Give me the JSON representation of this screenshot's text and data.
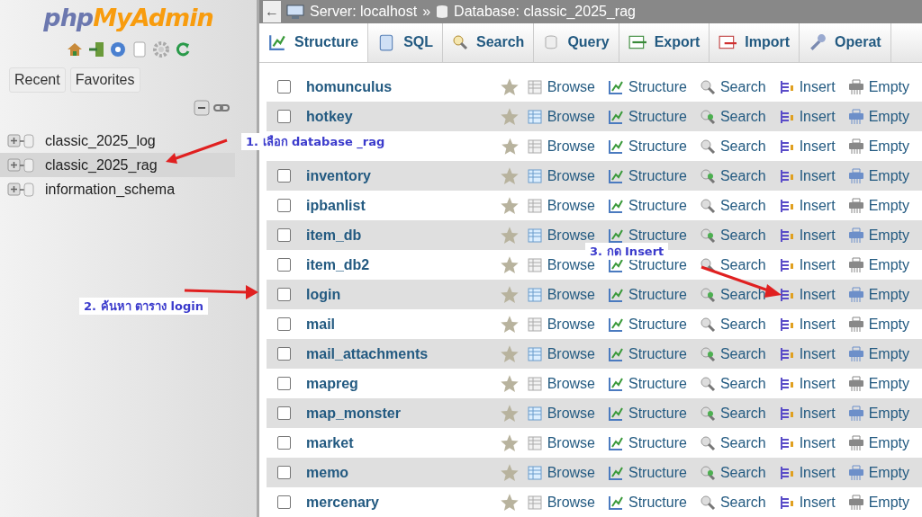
{
  "sidebar": {
    "logo": {
      "php": "php",
      "rest": "MyAdmin"
    },
    "buttons": [
      "Recent",
      "Favorites"
    ],
    "databases": [
      {
        "name": "classic_2025_log",
        "selected": false
      },
      {
        "name": "classic_2025_rag",
        "selected": true
      },
      {
        "name": "information_schema",
        "selected": false
      }
    ]
  },
  "breadcrumb": {
    "back": "←",
    "server": "Server: localhost",
    "separator": "»",
    "database": "Database: classic_2025_rag"
  },
  "tabs": [
    {
      "label": "Structure",
      "selected": true
    },
    {
      "label": "SQL",
      "selected": false
    },
    {
      "label": "Search",
      "selected": false
    },
    {
      "label": "Query",
      "selected": false
    },
    {
      "label": "Export",
      "selected": false
    },
    {
      "label": "Import",
      "selected": false
    },
    {
      "label": "Operat",
      "selected": false
    }
  ],
  "rows": [
    {
      "name": "homunculus",
      "checked": false,
      "actions": [
        "Browse",
        "Structure",
        "Search",
        "Insert",
        "Empty"
      ]
    },
    {
      "name": "hotkey",
      "checked": false,
      "actions": [
        "Browse",
        "Structure",
        "Search",
        "Insert",
        "Empty"
      ]
    },
    {
      "actions": [
        "Browse",
        "Structure",
        "Search",
        "Insert",
        "Empty"
      ]
    },
    {
      "name": "inventory",
      "checked": false,
      "actions": [
        "Browse",
        "Structure",
        "Search",
        "Insert",
        "Empty"
      ]
    },
    {
      "name": "ipbanlist",
      "checked": false,
      "actions": [
        "Browse",
        "Structure",
        "Search",
        "Insert",
        "Empty"
      ]
    },
    {
      "name": "item_db",
      "checked": false,
      "actions": [
        "Browse",
        "Structure",
        "Search",
        "Insert",
        "Empty"
      ]
    },
    {
      "name": "item_db2",
      "checked": false,
      "actions": [
        "Browse",
        "Structure",
        "Search",
        "Insert",
        "Empty"
      ]
    },
    {
      "name": "login",
      "checked": false,
      "actions": [
        "Browse",
        "Structure",
        "Search",
        "Insert",
        "Empty"
      ]
    },
    {
      "name": "mail",
      "checked": false,
      "actions": [
        "Browse",
        "Structure",
        "Search",
        "Insert",
        "Empty"
      ]
    },
    {
      "name": "mail_attachments",
      "checked": false,
      "actions": [
        "Browse",
        "Structure",
        "Search",
        "Insert",
        "Empty"
      ]
    },
    {
      "name": "mapreg",
      "checked": false,
      "actions": [
        "Browse",
        "Structure",
        "Search",
        "Insert",
        "Empty"
      ]
    },
    {
      "name": "map_monster",
      "checked": false,
      "actions": [
        "Browse",
        "Structure",
        "Search",
        "Insert",
        "Empty"
      ]
    },
    {
      "name": "market",
      "checked": false,
      "actions": [
        "Browse",
        "Structure",
        "Search",
        "Insert",
        "Empty"
      ]
    },
    {
      "name": "memo",
      "checked": false,
      "actions": [
        "Browse",
        "Structure",
        "Search",
        "Insert",
        "Empty"
      ]
    },
    {
      "name": "mercenary",
      "checked": false,
      "actions": [
        "Browse",
        "Structure",
        "Search",
        "Insert",
        "Empty"
      ]
    }
  ],
  "annotations": [
    {
      "text": "1. เลือก database _rag"
    },
    {
      "text": "2. ค้นหา ตาราง login"
    },
    {
      "text": "3. กด Insert"
    }
  ]
}
